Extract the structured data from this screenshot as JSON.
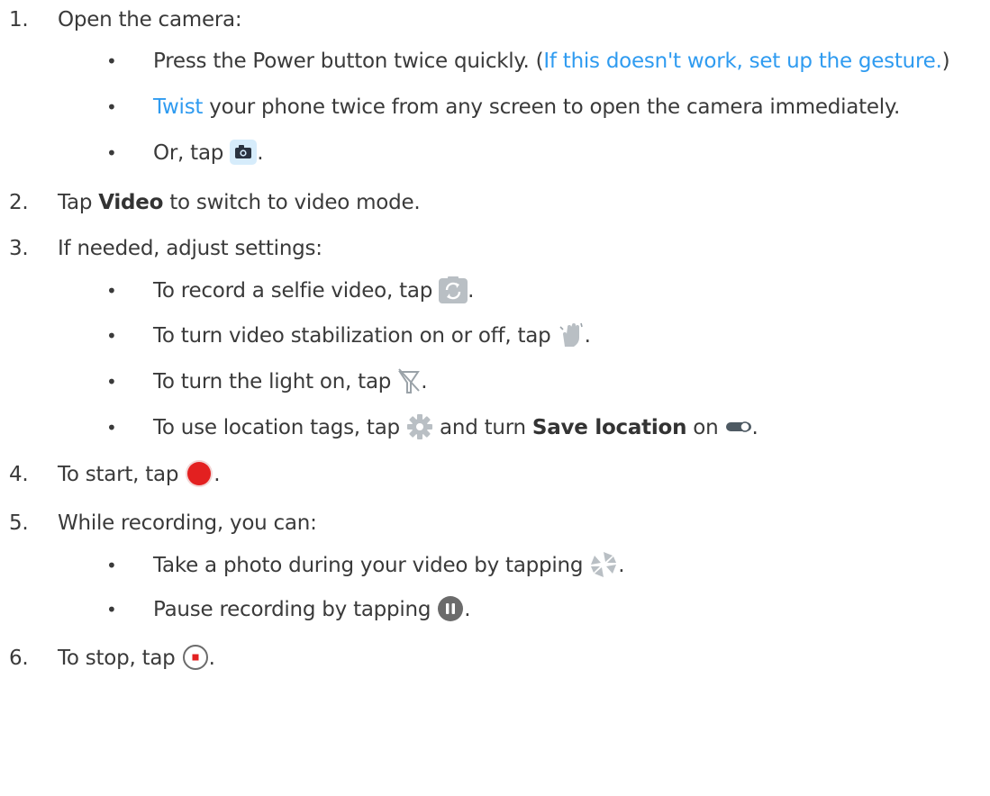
{
  "steps": [
    {
      "num": "1.",
      "text": "Open the camera:"
    },
    {
      "num": "2.",
      "pre": "Tap ",
      "bold": "Video",
      "post": " to switch to video mode."
    },
    {
      "num": "3.",
      "text": "If needed, adjust settings:"
    },
    {
      "num": "4.",
      "text": "To start, tap ",
      "post": "."
    },
    {
      "num": "5.",
      "text": "While recording, you can:"
    },
    {
      "num": "6.",
      "text": "To stop, tap ",
      "post": "."
    }
  ],
  "step1_bullets": {
    "b1": {
      "text": "Press the Power button twice quickly. (",
      "link": "If this doesn't work, set up the gesture.",
      "post": ")"
    },
    "b2": {
      "link": "Twist",
      "text": " your phone twice from any screen to open the camera immediately."
    },
    "b3": {
      "text": "Or, tap ",
      "post": "."
    }
  },
  "step3_bullets": {
    "b1": {
      "text": "To record a selfie video, tap ",
      "post": "."
    },
    "b2": {
      "text": "To turn video stabilization on or off, tap ",
      "post": "."
    },
    "b3": {
      "text": "To turn the light on, tap ",
      "post": "."
    },
    "b4": {
      "text": "To use location tags, tap ",
      "mid": " and turn ",
      "bold": "Save location",
      "post1": " on ",
      "post": "."
    }
  },
  "step5_bullets": {
    "b1": {
      "text": "Take a photo during your video by tapping ",
      "post": "."
    },
    "b2": {
      "text": "Pause recording by tapping ",
      "post": "."
    }
  },
  "bullet_char": "•",
  "icons": {
    "camera": "camera-icon",
    "switch_camera": "switch-camera-icon",
    "stabilization": "hand-stabilization-icon",
    "flash_off": "flash-off-icon",
    "settings": "gear-icon",
    "toggle": "toggle-on-icon",
    "record": "record-icon",
    "snapshot": "shutter-icon",
    "pause": "pause-icon",
    "stop": "stop-icon"
  },
  "colors": {
    "link": "#2f9bf0",
    "text": "#3a3a3a",
    "record": "#e32020",
    "pause": "#6b6b6b"
  }
}
